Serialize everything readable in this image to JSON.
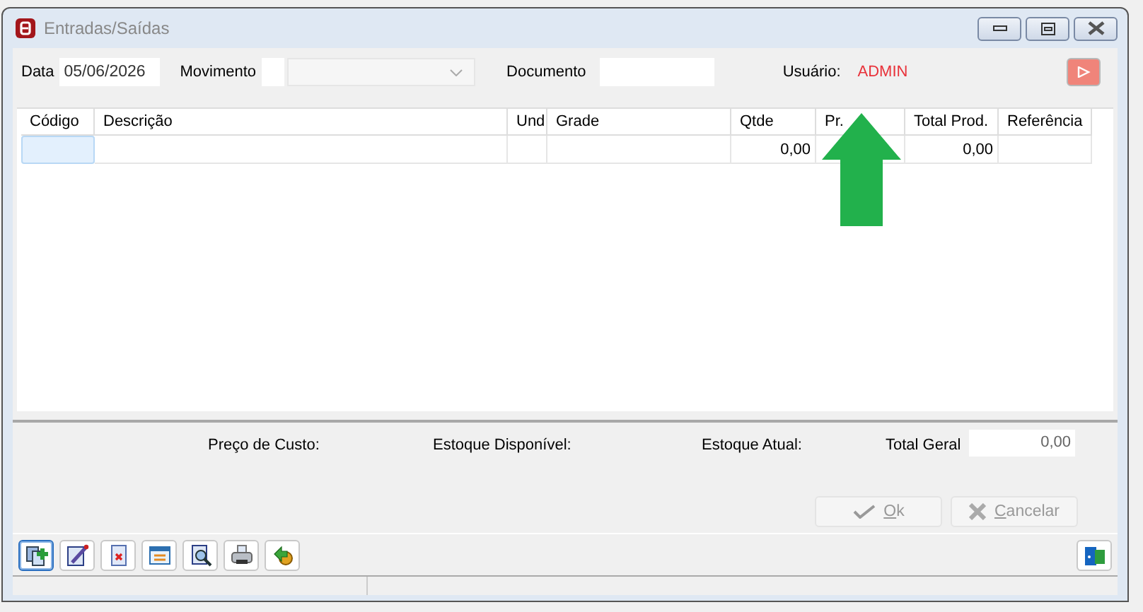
{
  "window": {
    "title": "Entradas/Saídas"
  },
  "form": {
    "date_label": "Data",
    "date_value": "05/06/2026",
    "movement_label": "Movimento",
    "document_label": "Documento",
    "user_label": "Usuário:",
    "user_value": "ADMIN"
  },
  "grid": {
    "columns": [
      {
        "label": "Código"
      },
      {
        "label": "Descrição"
      },
      {
        "label": "Und"
      },
      {
        "label": "Grade"
      },
      {
        "label": "Qtde"
      },
      {
        "label": "Pr."
      },
      {
        "label": "Total Prod."
      },
      {
        "label": "Referência"
      }
    ],
    "rows": [
      {
        "cells": [
          {
            "selected": true
          },
          {
            "selected": false
          },
          {
            "selected": false
          },
          {
            "selected": false
          },
          {
            "text": "0,00",
            "selected": false
          },
          {
            "selected": false
          },
          {
            "text": "0,00",
            "selected": false
          },
          {
            "selected": false
          }
        ]
      }
    ]
  },
  "summary": {
    "labels": [
      "Preço de Custo:",
      "Estoque Disponível:",
      "Estoque Atual:"
    ],
    "total_label": "Total Geral",
    "total_value": "0,00"
  },
  "actions": [
    {
      "kind": "ok",
      "label": "Ok",
      "disabled": true
    },
    {
      "kind": "cancel",
      "label": "Cancelar",
      "disabled": true
    }
  ],
  "toolbar": [
    {
      "kind": "new",
      "selected": true
    },
    {
      "kind": "edit",
      "selected": false
    },
    {
      "kind": "delete",
      "selected": false
    },
    {
      "kind": "list",
      "selected": false
    },
    {
      "kind": "search",
      "selected": false
    },
    {
      "kind": "print",
      "selected": false
    },
    {
      "kind": "tools",
      "selected": false
    }
  ],
  "annotation": {
    "kind": "arrow"
  }
}
